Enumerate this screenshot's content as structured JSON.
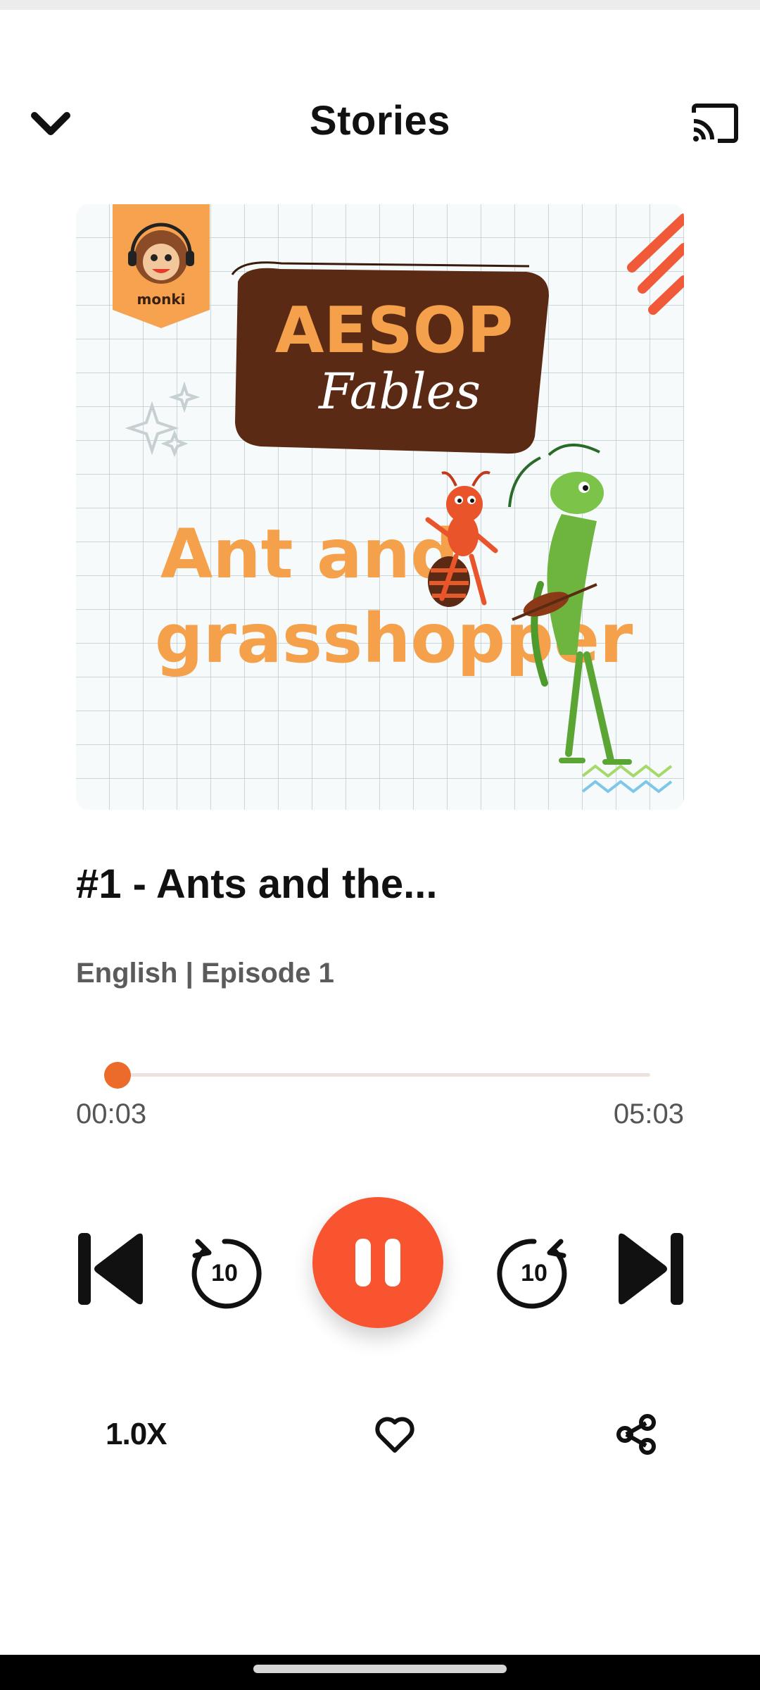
{
  "header": {
    "title": "Stories",
    "back_icon": "chevron-down-icon",
    "cast_icon": "cast-icon"
  },
  "artwork": {
    "logo_text": "monki",
    "headline": "AESOP",
    "script_text": "Fables",
    "story_line1": "Ant and",
    "story_line2": "grasshopper"
  },
  "episode": {
    "title": "#1 - Ants and the...",
    "subtitle": "English | Episode 1"
  },
  "player": {
    "elapsed": "00:03",
    "total": "05:03",
    "progress_fraction": 0.01,
    "rewind_label": "10",
    "forward_label": "10",
    "state": "playing"
  },
  "actions": {
    "speed_label": "1.0X",
    "favorite_icon": "heart-icon",
    "share_icon": "share-icon"
  },
  "colors": {
    "accent": "#F8542F",
    "progress": "#EC6A2A",
    "artwork_orange": "#F5A04A",
    "artwork_brown": "#5A2A14"
  }
}
